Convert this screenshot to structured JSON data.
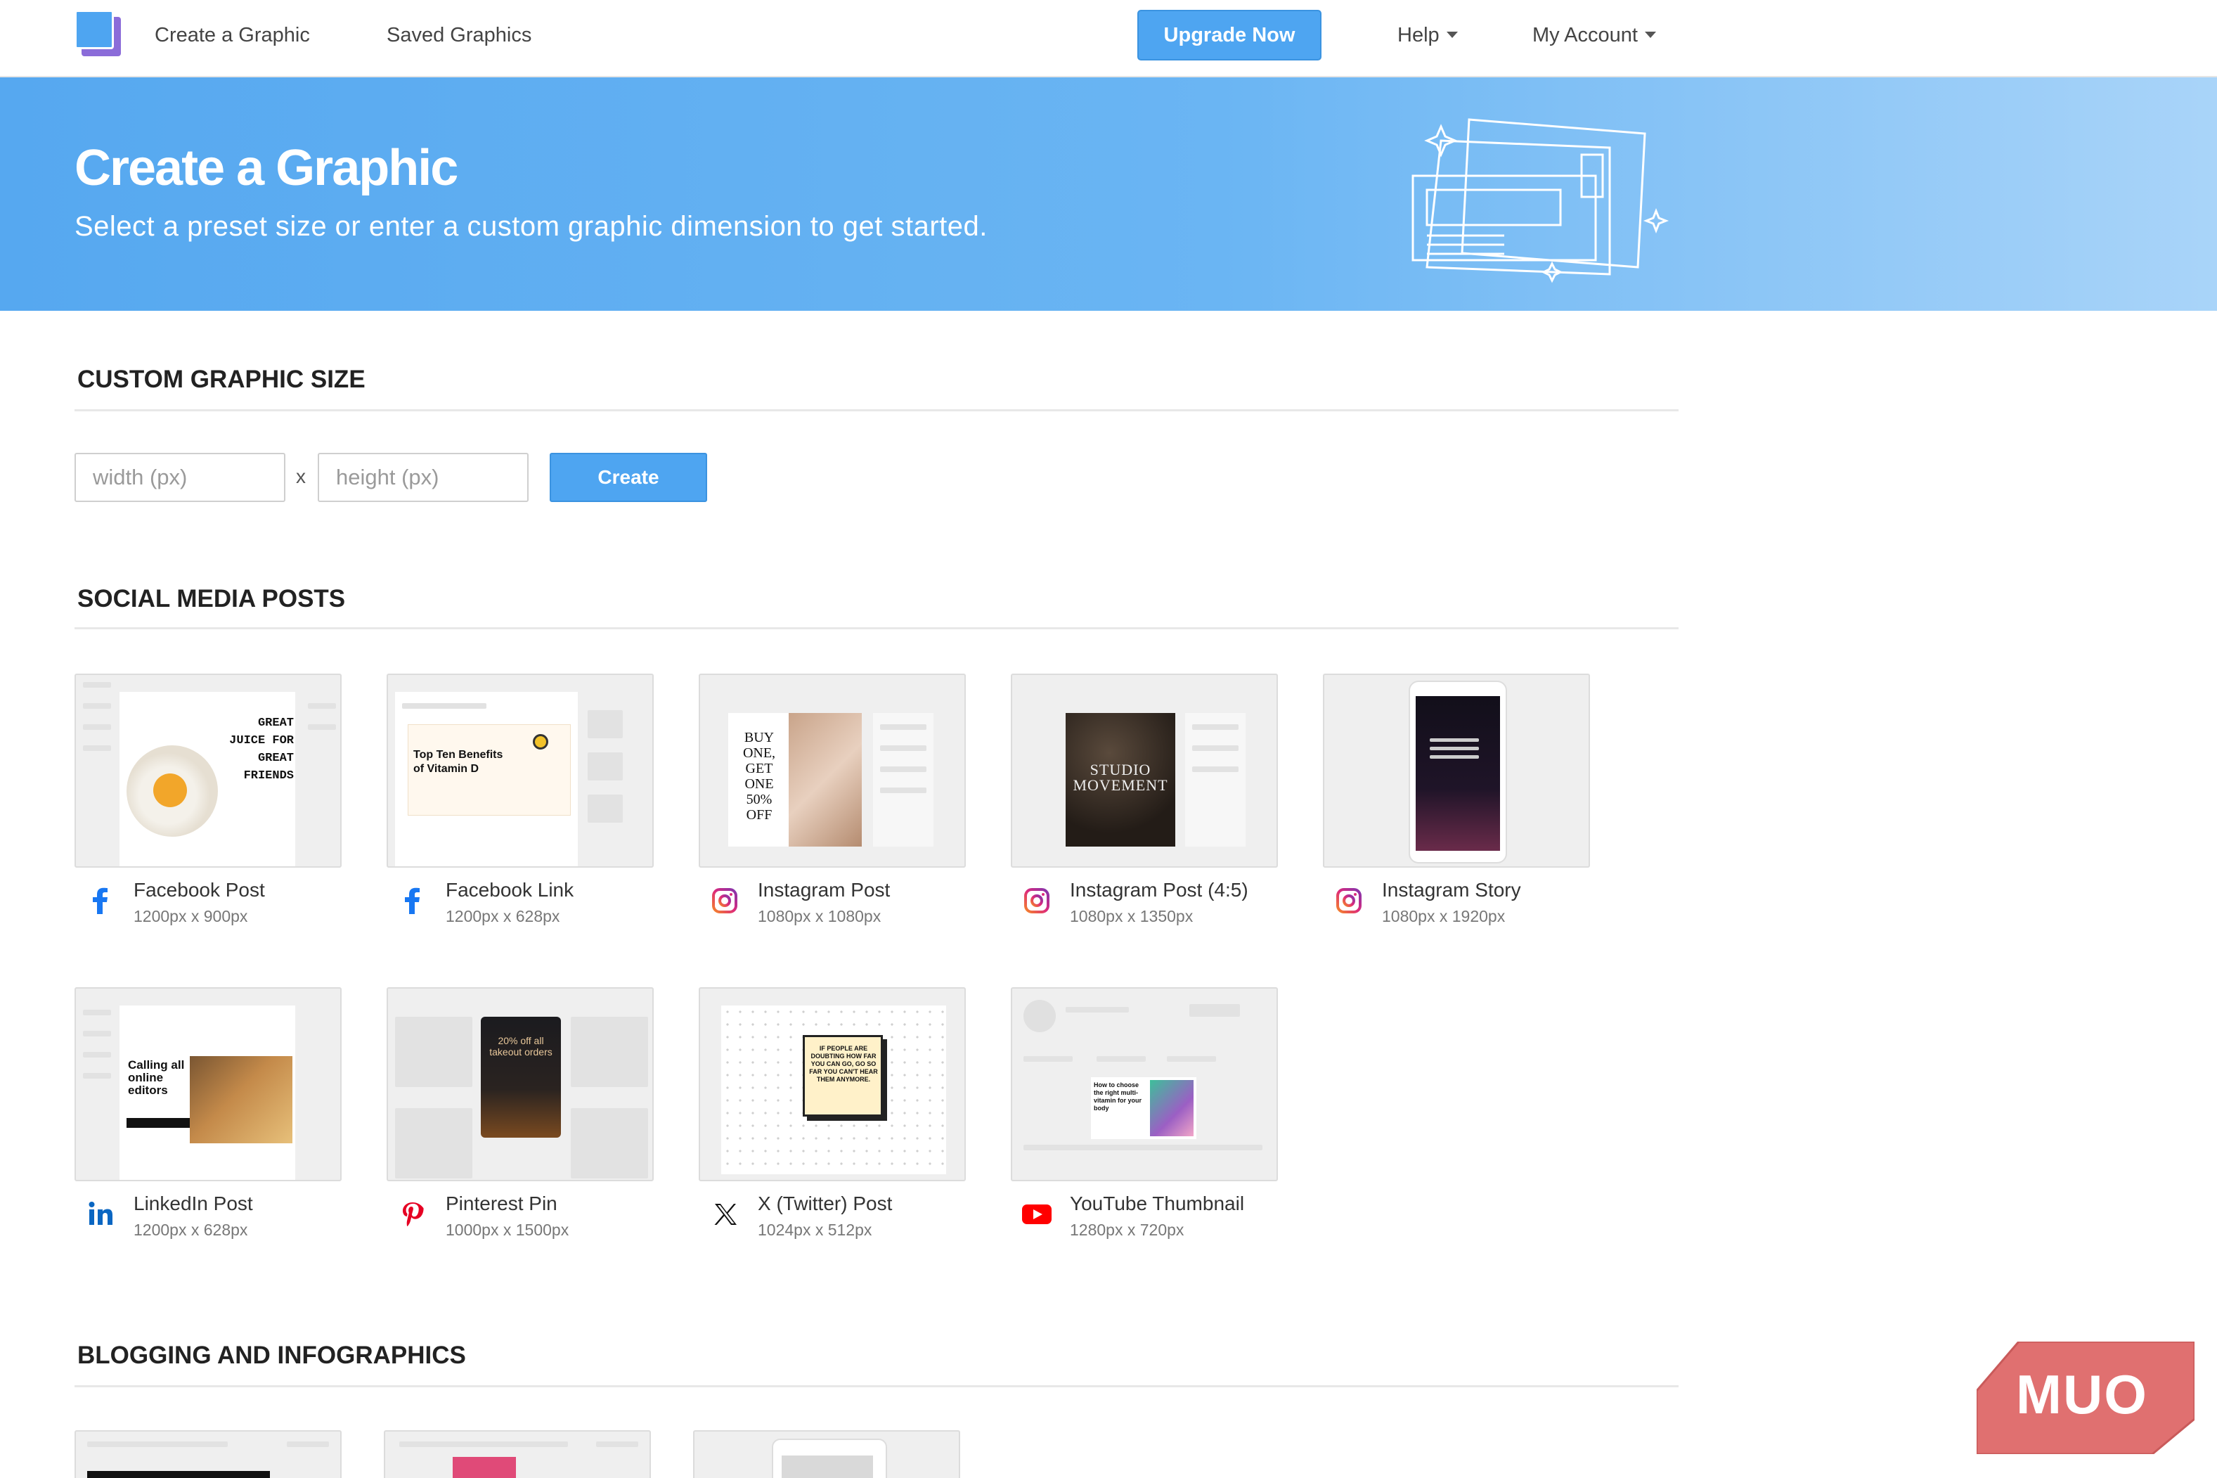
{
  "nav": {
    "create_label": "Create a Graphic",
    "saved_label": "Saved Graphics",
    "upgrade_label": "Upgrade Now",
    "help_label": "Help",
    "account_label": "My Account"
  },
  "hero": {
    "title": "Create a Graphic",
    "subtitle": "Select a preset size or enter a custom graphic dimension to get started."
  },
  "custom": {
    "heading": "CUSTOM GRAPHIC SIZE",
    "width_placeholder": "width (px)",
    "height_placeholder": "height (px)",
    "times": "x",
    "create_label": "Create"
  },
  "social": {
    "heading": "SOCIAL MEDIA POSTS",
    "items": [
      {
        "name": "Facebook Post",
        "dims": "1200px x 900px",
        "icon": "facebook-icon"
      },
      {
        "name": "Facebook Link",
        "dims": "1200px x 628px",
        "icon": "facebook-icon"
      },
      {
        "name": "Instagram Post",
        "dims": "1080px x 1080px",
        "icon": "instagram-icon"
      },
      {
        "name": "Instagram Post (4:5)",
        "dims": "1080px x 1350px",
        "icon": "instagram-icon"
      },
      {
        "name": "Instagram Story",
        "dims": "1080px x 1920px",
        "icon": "instagram-icon"
      },
      {
        "name": "LinkedIn Post",
        "dims": "1200px x 628px",
        "icon": "linkedin-icon"
      },
      {
        "name": "Pinterest Pin",
        "dims": "1000px x 1500px",
        "icon": "pinterest-icon"
      },
      {
        "name": "X (Twitter) Post",
        "dims": "1024px x 512px",
        "icon": "x-icon"
      },
      {
        "name": "YouTube Thumbnail",
        "dims": "1280px x 720px",
        "icon": "youtube-icon"
      }
    ]
  },
  "previews": {
    "fb_post": [
      "GREAT",
      "JUICE FOR",
      "GREAT",
      "FRIENDS"
    ],
    "fb_link": "Top Ten Benefits of Vitamin D",
    "ig_post": [
      "BUY",
      "ONE,",
      "GET",
      "ONE",
      "50%",
      "OFF"
    ],
    "ig_45": "STUDIO MOVEMENT",
    "linkedin": "Calling all online editors",
    "pinterest": "20% off all takeout orders",
    "twitter": "IF PEOPLE ARE DOUBTING HOW FAR YOU CAN GO, GO SO FAR YOU CAN'T HEAR THEM ANYMORE.",
    "youtube": "How to choose the right multi-vitamin for your body"
  },
  "blogging": {
    "heading": "BLOGGING AND INFOGRAPHICS"
  },
  "watermark": "MUO",
  "colors": {
    "accent": "#4ea5f1",
    "facebook": "#1877f2",
    "instagram": "#c13584",
    "linkedin": "#0a66c2",
    "pinterest": "#e60023",
    "youtube": "#ff0000",
    "watermark": "#e07070"
  }
}
